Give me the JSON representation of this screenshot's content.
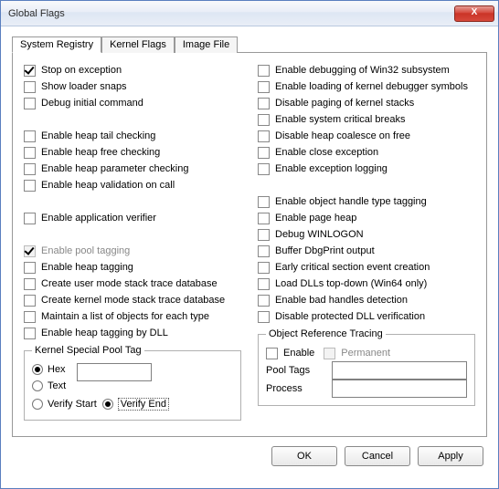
{
  "window": {
    "title": "Global Flags",
    "close_x": "X"
  },
  "tabs": [
    "System Registry",
    "Kernel Flags",
    "Image File"
  ],
  "left": {
    "stop_exception": "Stop on exception",
    "show_loader": "Show loader snaps",
    "debug_initial": "Debug initial command",
    "heap_tail": "Enable heap tail checking",
    "heap_free": "Enable heap free checking",
    "heap_param": "Enable heap parameter checking",
    "heap_valid": "Enable heap validation on call",
    "app_verifier": "Enable application verifier",
    "pool_tagging": "Enable pool tagging",
    "heap_tagging": "Enable heap tagging",
    "user_stack": "Create user mode stack trace database",
    "kernel_stack": "Create kernel mode stack trace database",
    "maintain_list": "Maintain a list of objects for each type",
    "heap_tag_dll": "Enable heap tagging by DLL"
  },
  "right": {
    "debug_win32": "Enable debugging of Win32 subsystem",
    "load_dbg_sym": "Enable loading of kernel debugger symbols",
    "disable_paging": "Disable paging of kernel stacks",
    "sys_crit": "Enable system critical breaks",
    "disable_coalesce": "Disable heap coalesce on free",
    "close_exc": "Enable close exception",
    "exc_logging": "Enable exception logging",
    "obj_handle": "Enable object handle type tagging",
    "page_heap": "Enable page heap",
    "debug_winlogon": "Debug WINLOGON",
    "buffer_dbgprint": "Buffer DbgPrint output",
    "early_crit": "Early critical section event creation",
    "load_dlls": "Load DLLs top-down (Win64 only)",
    "bad_handles": "Enable bad handles detection",
    "disable_prot_dll": "Disable protected DLL verification"
  },
  "pool_group": {
    "legend": "Kernel Special Pool Tag",
    "hex": "Hex",
    "text": "Text",
    "verify_start": "Verify Start",
    "verify_end": "Verify End"
  },
  "obj_group": {
    "legend": "Object Reference Tracing",
    "enable": "Enable",
    "permanent": "Permanent",
    "pool_tags": "Pool Tags",
    "process": "Process"
  },
  "buttons": {
    "ok": "OK",
    "cancel": "Cancel",
    "apply": "Apply"
  }
}
